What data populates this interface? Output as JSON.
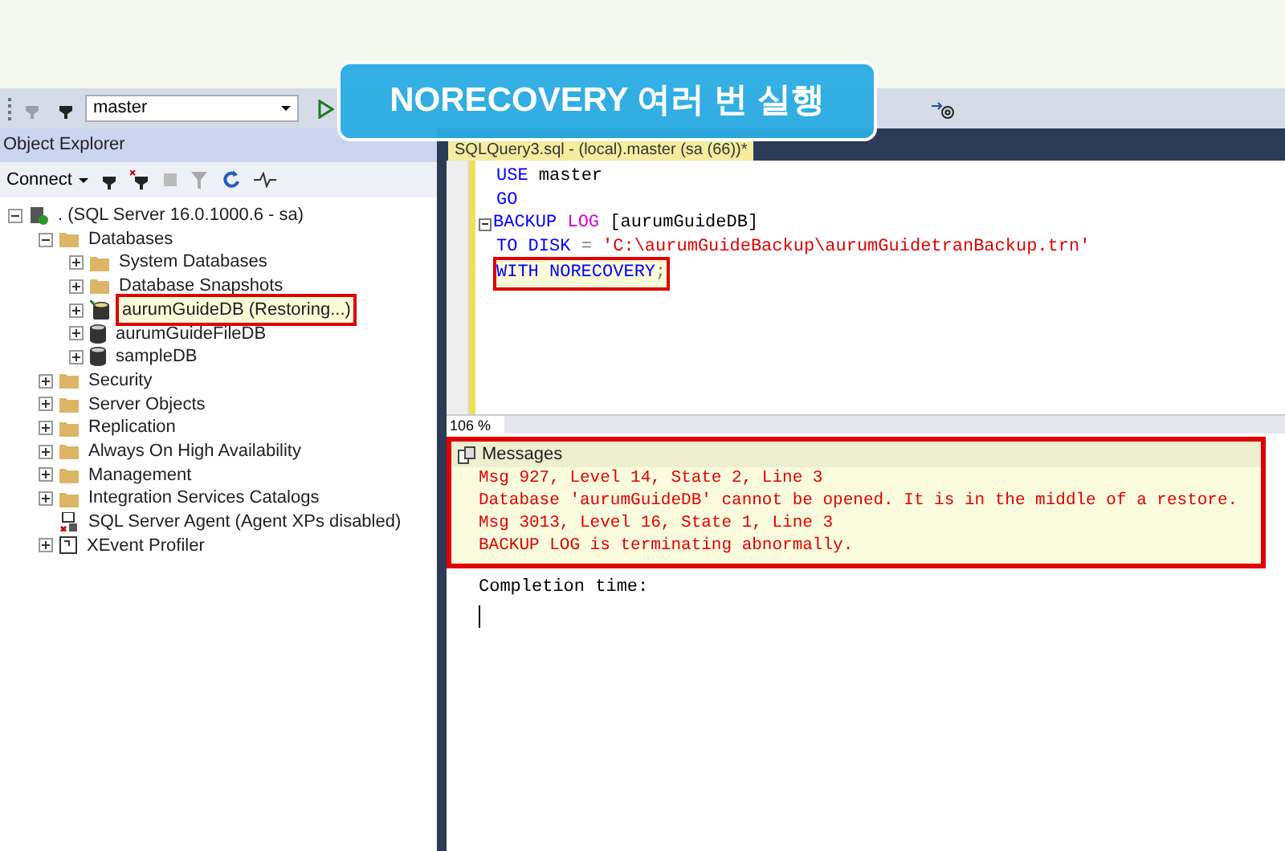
{
  "callout": {
    "text": "NORECOVERY 여러 번 실행"
  },
  "toolbar": {
    "database": "master"
  },
  "object_explorer": {
    "title": "Object Explorer",
    "connect": "Connect",
    "tree": [
      {
        "label": ". (SQL Server 16.0.1000.6 - sa)",
        "kind": "server",
        "expanded": true,
        "highlighted": false,
        "children": [
          {
            "label": "Databases",
            "kind": "folder",
            "expanded": true,
            "highlighted": false,
            "children": [
              {
                "label": "System Databases",
                "kind": "folder",
                "expanded": false,
                "highlighted": false
              },
              {
                "label": "Database Snapshots",
                "kind": "folder",
                "expanded": false,
                "highlighted": false
              },
              {
                "label": "aurumGuideDB (Restoring...)",
                "kind": "restoring-db",
                "expanded": false,
                "highlighted": true
              },
              {
                "label": "aurumGuideFileDB",
                "kind": "db",
                "expanded": false,
                "highlighted": false
              },
              {
                "label": "sampleDB",
                "kind": "db",
                "expanded": false,
                "highlighted": false
              }
            ]
          },
          {
            "label": "Security",
            "kind": "folder",
            "expanded": false,
            "highlighted": false
          },
          {
            "label": "Server Objects",
            "kind": "folder",
            "expanded": false,
            "highlighted": false
          },
          {
            "label": "Replication",
            "kind": "folder",
            "expanded": false,
            "highlighted": false
          },
          {
            "label": "Always On High Availability",
            "kind": "folder",
            "expanded": false,
            "highlighted": false
          },
          {
            "label": "Management",
            "kind": "folder",
            "expanded": false,
            "highlighted": false
          },
          {
            "label": "Integration Services Catalogs",
            "kind": "folder",
            "expanded": false,
            "highlighted": false
          },
          {
            "label": "SQL Server Agent (Agent XPs disabled)",
            "kind": "agent",
            "leaf": true,
            "highlighted": false
          },
          {
            "label": "XEvent Profiler",
            "kind": "xevent",
            "expanded": false,
            "highlighted": false
          }
        ]
      }
    ]
  },
  "editor": {
    "tab": "SQLQuery3.sql - (local).master (sa (66))*",
    "zoom": "106 %",
    "lines": [
      {
        "collapsible": false,
        "highlighted": false,
        "tokens": [
          {
            "kind": "keyword",
            "text": "USE"
          },
          {
            "kind": "plain",
            "text": " master"
          }
        ]
      },
      {
        "collapsible": false,
        "highlighted": false,
        "tokens": [
          {
            "kind": "keyword",
            "text": "GO"
          }
        ]
      },
      {
        "collapsible": true,
        "highlighted": false,
        "tokens": [
          {
            "kind": "keyword",
            "text": "BACKUP "
          },
          {
            "kind": "function",
            "text": "LOG"
          },
          {
            "kind": "plain",
            "text": " [aurumGuideDB]"
          }
        ]
      },
      {
        "collapsible": false,
        "highlighted": false,
        "tokens": [
          {
            "kind": "keyword",
            "text": "TO DISK"
          },
          {
            "kind": "operator",
            "text": " = "
          },
          {
            "kind": "string",
            "text": "'C:\\aurumGuideBackup\\aurumGuidetranBackup.trn'"
          }
        ]
      },
      {
        "collapsible": false,
        "highlighted": true,
        "tokens": [
          {
            "kind": "keyword",
            "text": "WITH NORECOVERY"
          },
          {
            "kind": "operator",
            "text": ";"
          }
        ]
      }
    ]
  },
  "messages": {
    "tab": "Messages",
    "highlighted": true,
    "errors": [
      "Msg 927, Level 14, State 2, Line 3",
      "Database 'aurumGuideDB' cannot be opened. It is in the middle of a restore.",
      "Msg 3013, Level 16, State 1, Line 3",
      "BACKUP LOG is terminating abnormally."
    ],
    "completion": "Completion time:"
  }
}
